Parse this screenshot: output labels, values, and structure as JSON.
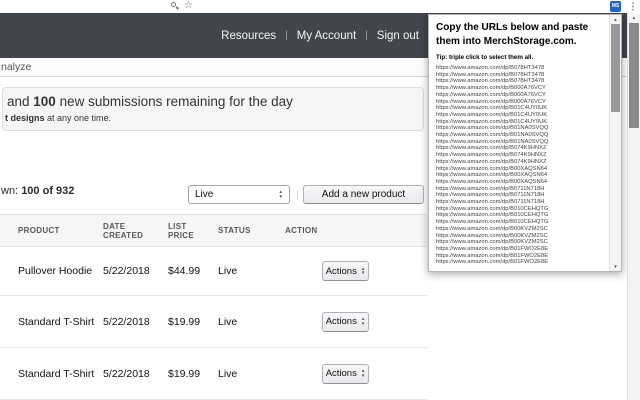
{
  "browser": {
    "extension_icon_label": "MS",
    "menu_icon": "⋮",
    "star_icon": "☆",
    "arrow_up": "▲",
    "arrow_down": "▼"
  },
  "header": {
    "links": [
      "Resources",
      "My Account",
      "Sign out"
    ],
    "separator": "|"
  },
  "nav": {
    "visible_label": "nalyze"
  },
  "notice": {
    "line1_prefix": "and ",
    "line1_bold": "100",
    "line1_suffix": " new submissions remaining for the day",
    "line2_bold": "t designs",
    "line2_suffix": " at any one time."
  },
  "controls": {
    "shown_prefix": "wn: ",
    "shown_bold": "100 of 932",
    "filter_value": "Live",
    "add_button_label": "Add a new product"
  },
  "table": {
    "columns": [
      "PRODUCT",
      "DATE CREATED",
      "LIST PRICE",
      "STATUS",
      "ACTION"
    ],
    "action_button_label": "Actions",
    "rows": [
      {
        "product": "Pullover Hoodie",
        "date": "5/22/2018",
        "price": "$44.99",
        "status": "Live"
      },
      {
        "product": "Standard T-Shirt",
        "date": "5/22/2018",
        "price": "$19.99",
        "status": "Live"
      },
      {
        "product": "Standard T-Shirt",
        "date": "5/22/2018",
        "price": "$19.99",
        "status": "Live"
      }
    ]
  },
  "popup": {
    "heading": "Copy the URLs below and paste them into MerchStorage.com.",
    "tip": "Tip: triple click to select them all.",
    "urls": [
      "https://www.amazon.com/dp/B078HT3478",
      "https://www.amazon.com/dp/B078HT3478",
      "https://www.amazon.com/dp/B078HT3478",
      "https://www.amazon.com/dp/B000A76VCY",
      "https://www.amazon.com/dp/B000A76VCY",
      "https://www.amazon.com/dp/B000A76VCY",
      "https://www.amazon.com/dp/B01C4UY0UK",
      "https://www.amazon.com/dp/B01C4UY0UK",
      "https://www.amazon.com/dp/B01C4UY0UK",
      "https://www.amazon.com/dp/B01NA0SVQQ",
      "https://www.amazon.com/dp/B01NA0SVQQ",
      "https://www.amazon.com/dp/B01NA0SVQQ",
      "https://www.amazon.com/dp/B074K9HNXZ",
      "https://www.amazon.com/dp/B074K9HNXZ",
      "https://www.amazon.com/dp/B074K9HNXZ",
      "https://www.amazon.com/dp/B00XAQSN64",
      "https://www.amazon.com/dp/B00XAQSN64",
      "https://www.amazon.com/dp/B00XAQSN64",
      "https://www.amazon.com/dp/B0711N718H",
      "https://www.amazon.com/dp/B0711N718H",
      "https://www.amazon.com/dp/B0711N718H",
      "https://www.amazon.com/dp/B010CEHQTG",
      "https://www.amazon.com/dp/B010CEHQTG",
      "https://www.amazon.com/dp/B010CEHQTG",
      "https://www.amazon.com/dp/B00KVZM2SC",
      "https://www.amazon.com/dp/B00KVZM2SC",
      "https://www.amazon.com/dp/B00KVZM2SC",
      "https://www.amazon.com/dp/B01FWO2E8E",
      "https://www.amazon.com/dp/B01FWO2E8E",
      "https://www.amazon.com/dp/B01FWO2E8E"
    ]
  }
}
